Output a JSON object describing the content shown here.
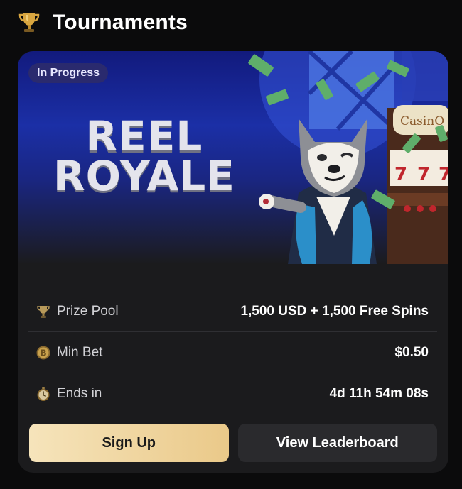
{
  "header": {
    "title": "Tournaments",
    "icon": "trophy-icon"
  },
  "tournament": {
    "status_badge": "In Progress",
    "title_line1": "REEL",
    "title_line2": "ROYALE",
    "machine_sign": "CasinO",
    "details": [
      {
        "icon": "trophy-icon",
        "label": "Prize Pool",
        "value": "1,500 USD + 1,500 Free Spins"
      },
      {
        "icon": "bitcoin-coin-icon",
        "label": "Min Bet",
        "value": "$0.50"
      },
      {
        "icon": "stopwatch-icon",
        "label": "Ends in",
        "value": "4d 11h 54m 08s"
      }
    ],
    "buttons": {
      "sign_up": "Sign Up",
      "leaderboard": "View Leaderboard"
    }
  },
  "colors": {
    "page_bg": "#0b0b0c",
    "card_bg": "#1b1b1d",
    "banner_blue": "#1b2fa6",
    "badge_bg": "#2a2a6e",
    "gold_start": "#f6e4bb",
    "gold_end": "#eac989",
    "secondary_button": "#2a2a2d"
  }
}
